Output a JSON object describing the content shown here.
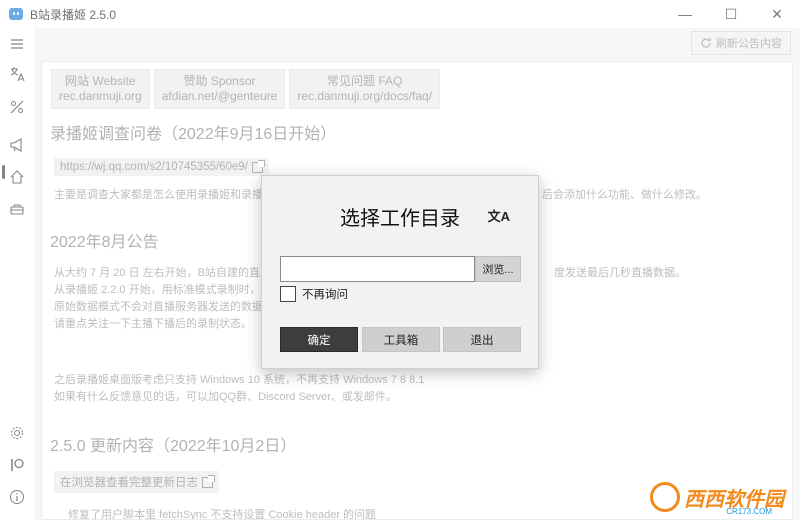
{
  "window": {
    "title": "B站录播姬 2.5.0",
    "minimize": "—",
    "maximize": "☐",
    "close": "✕"
  },
  "sidebar": {
    "icons": [
      "menu-icon",
      "translate-icon",
      "slash-icon",
      "megaphone-icon",
      "home-icon",
      "tool-icon",
      "gear-icon",
      "patreon-icon",
      "info-icon"
    ]
  },
  "toolbar": {
    "refresh_label": "刷新公告内容"
  },
  "announcement": {
    "links": [
      {
        "line1": "网站 Website",
        "line2": "rec.danmuji.org"
      },
      {
        "line1": "赞助 Sponsor",
        "line2": "afdian.net/@genteure"
      },
      {
        "line1": "常见问题 FAQ",
        "line2": "rec.danmuji.org/docs/faq/"
      }
    ],
    "survey_title": "录播姬调查问卷（2022年9月16日开始）",
    "survey_url": "https://wj.qq.com/s2/10745355/60e9/",
    "survey_desc_left": "主要是调查大家都是怎么使用录播姬和录播",
    "survey_desc_right": "后会添加什么功能、做什么修改。",
    "aug_title": "2022年8月公告",
    "aug_lines_left": [
      "从大约 7 月 20 日 左右开始，B站自建的直",
      "从录播姬 2.2.0 开始，用标准模式录制时，",
      "原始数据模式不会对直播服务器发送的数据",
      "请重点关注一下主播下播后的录制状态。"
    ],
    "aug_line_right": "度发送最后几秒直播数据。",
    "win_line": "之后录播姬桌面版考虑只支持 Windows 10 系统，不再支持 Windows 7 8 8.1",
    "feedback_line": "如果有什么反馈意见的话，可以加QQ群、Discord Server、或发邮件。",
    "update_title": "2.5.0 更新内容（2022年10月2日）",
    "update_link": "在浏览器查看完整更新日志",
    "cut_line": "修复了用户脚本里 fetchSync 不支持设置 Cookie header 的问题"
  },
  "dialog": {
    "title": "选择工作目录",
    "translate_icon": "文A",
    "input_value": "",
    "browse_label": "浏览...",
    "checkbox_label": "不再询问",
    "confirm_label": "确定",
    "toolbox_label": "工具箱",
    "exit_label": "退出"
  },
  "watermark": {
    "brand": "西西软件园",
    "url": "CR173.COM"
  },
  "colors": {
    "primary_button": "#3d3d3d",
    "watermark": "#f28b1c",
    "app_icon": "#1e7fd8"
  }
}
